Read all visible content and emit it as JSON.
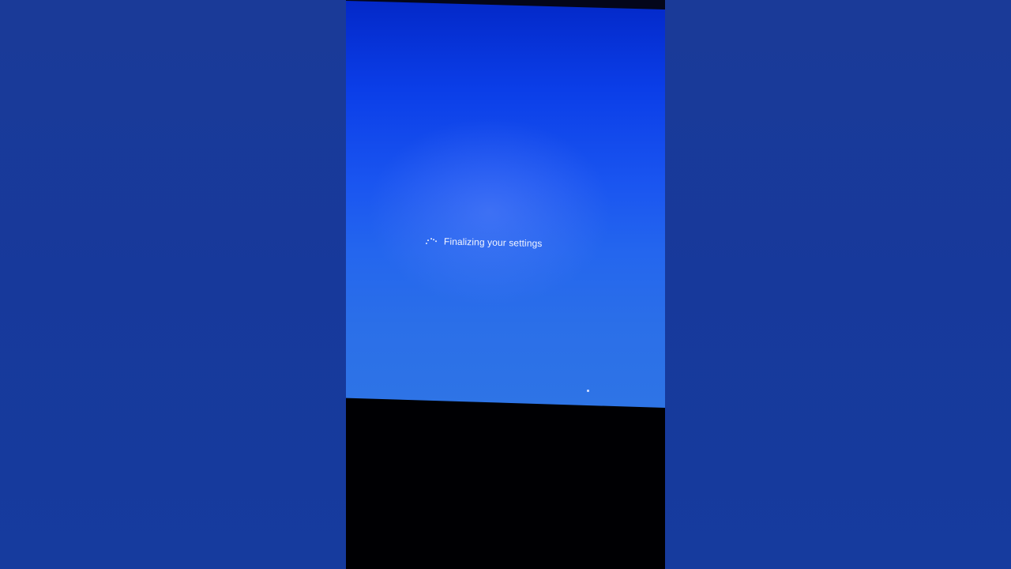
{
  "screen": {
    "status_text": "Finalizing your settings",
    "spinner_icon": "loading-spinner-icon",
    "cursor_icon": "mouse-cursor-icon"
  },
  "colors": {
    "pillarbox": "#17399a",
    "screen_top": "#0328c8",
    "screen_bottom": "#2e74e6",
    "below_screen": "#000003",
    "text": "#f1f4ff"
  }
}
